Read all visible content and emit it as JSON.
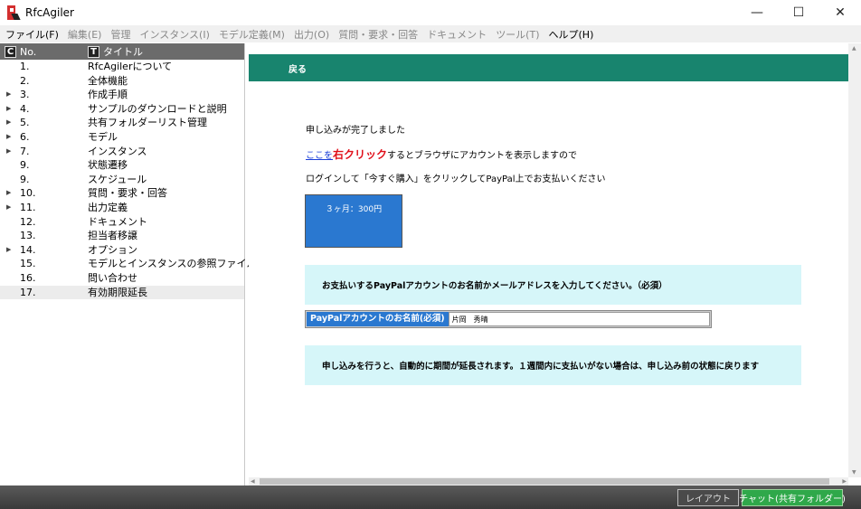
{
  "app": {
    "title": "RfcAgiler"
  },
  "window_controls": {
    "minimize": "—",
    "maximize": "☐",
    "close": "✕"
  },
  "menu": [
    {
      "label": "ファイル(F)",
      "active": true
    },
    {
      "label": "編集(E)",
      "active": false
    },
    {
      "label": "管理",
      "active": false
    },
    {
      "label": "インスタンス(I)",
      "active": false
    },
    {
      "label": "モデル定義(M)",
      "active": false
    },
    {
      "label": "出力(O)",
      "active": false
    },
    {
      "label": "質問・要求・回答",
      "active": false
    },
    {
      "label": "ドキュメント",
      "active": false
    },
    {
      "label": "ツール(T)",
      "active": false
    },
    {
      "label": "ヘルプ(H)",
      "active": true
    }
  ],
  "tree": {
    "header_no_icon": "C",
    "header_no": "No.",
    "header_title_icon": "T",
    "header_title": "タイトル",
    "rows": [
      {
        "no": "1.",
        "title": "RfcAgilerについて",
        "expandable": false,
        "selected": false
      },
      {
        "no": "2.",
        "title": "全体機能",
        "expandable": false,
        "selected": false
      },
      {
        "no": "3.",
        "title": "作成手順",
        "expandable": true,
        "selected": false
      },
      {
        "no": "4.",
        "title": "サンプルのダウンロードと説明",
        "expandable": true,
        "selected": false
      },
      {
        "no": "5.",
        "title": "共有フォルダーリスト管理",
        "expandable": true,
        "selected": false
      },
      {
        "no": "6.",
        "title": "モデル",
        "expandable": true,
        "selected": false
      },
      {
        "no": "7.",
        "title": "インスタンス",
        "expandable": true,
        "selected": false
      },
      {
        "no": "9.",
        "title": "状態遷移",
        "expandable": false,
        "selected": false
      },
      {
        "no": "9.",
        "title": "スケジュール",
        "expandable": false,
        "selected": false
      },
      {
        "no": "10.",
        "title": "質問・要求・回答",
        "expandable": true,
        "selected": false
      },
      {
        "no": "11.",
        "title": "出力定義",
        "expandable": true,
        "selected": false
      },
      {
        "no": "12.",
        "title": "ドキュメント",
        "expandable": false,
        "selected": false
      },
      {
        "no": "13.",
        "title": "担当者移譲",
        "expandable": false,
        "selected": false
      },
      {
        "no": "14.",
        "title": "オプション",
        "expandable": true,
        "selected": false
      },
      {
        "no": "15.",
        "title": "モデルとインスタンスの参照ファイルと...",
        "expandable": false,
        "selected": false
      },
      {
        "no": "16.",
        "title": "問い合わせ",
        "expandable": false,
        "selected": false
      },
      {
        "no": "17.",
        "title": "有効期限延長",
        "expandable": false,
        "selected": true
      }
    ]
  },
  "content": {
    "back_label": "戻る",
    "msg_complete": "申し込みが完了しました",
    "msg_link": "ここを",
    "msg_right_click": "右クリック",
    "msg_after_link": "するとブラウザにアカウントを表示しますので",
    "msg_login": "ログインして「今すぐ購入」をクリックしてPayPal上でお支払いください",
    "buy_button": "３ヶ月：300円",
    "info_enter": "お支払いするPayPalアカウントのお名前かメールアドレスを入力してください。（必須）",
    "input_label": "PayPalアカウントのお名前(必須)",
    "input_value": "片岡　秀晴",
    "info_extend": "申し込みを行うと、自動的に期間が延長されます。１週間内に支払いがない場合は、申し込み前の状態に戻ります"
  },
  "bottom": {
    "layout_button": "レイアウト",
    "chat_button": "チャット(共有フォルダー)"
  }
}
